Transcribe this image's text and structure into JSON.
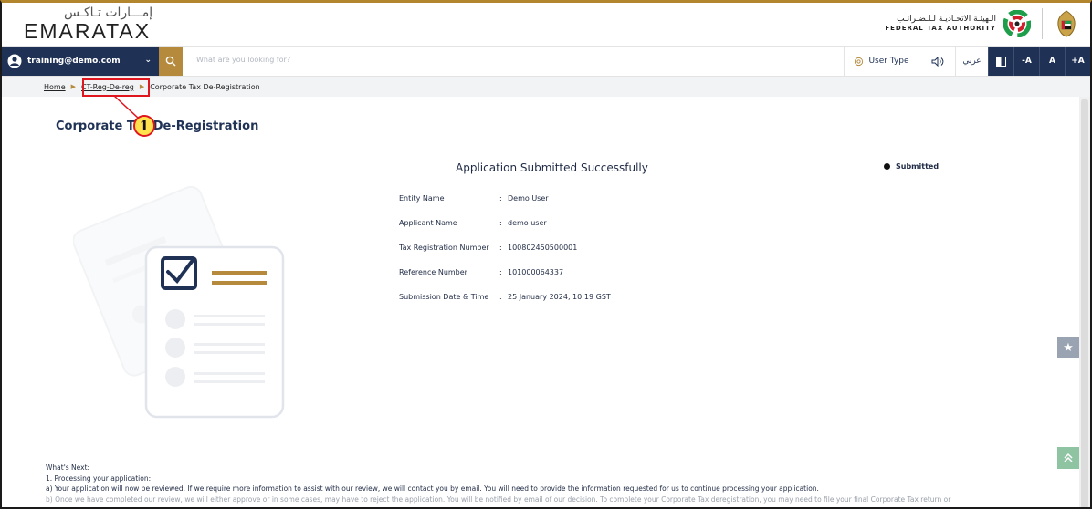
{
  "header": {
    "logo_ar": "إمـــارات تـاكـس",
    "logo_en": "EMARATAX",
    "fta_ar": "الـهيئـة الاتحـاديـة لـلـضـرائـب",
    "fta_en": "FEDERAL TAX AUTHORITY"
  },
  "nav": {
    "user_email": "training@demo.com",
    "search_placeholder": "What are you looking for?",
    "user_type_label": "User Type",
    "language_label": "عربي",
    "font_decrease": "-A",
    "font_normal": "A",
    "font_increase": "+A"
  },
  "breadcrumb": {
    "home": "Home",
    "parent": "CT-Reg-De-reg",
    "current": "Corporate Tax De-Registration"
  },
  "callout_number": "1",
  "page_title": "Corporate Tax De-Registration",
  "main": {
    "success_title": "Application Submitted Successfully",
    "status": "Submitted",
    "details": [
      {
        "label": "Entity Name",
        "value": "Demo User"
      },
      {
        "label": "Applicant Name",
        "value": "demo user"
      },
      {
        "label": "Tax Registration Number",
        "value": "100802450500001"
      },
      {
        "label": "Reference Number",
        "value": "101000064337"
      },
      {
        "label": "Submission Date & Time",
        "value": "25 January 2024, 10:19 GST"
      }
    ]
  },
  "whats_next": {
    "heading": "What's Next:",
    "step1": "1. Processing your application:",
    "step1a": "a) Your application will now be reviewed. If we require more information to assist with our review, we will contact you by email. You will need to provide the information requested for us to continue processing your application.",
    "step1b": "b) Once we have completed our review, we will either approve or in some cases, may have to reject the application. You will be notified by email of our decision. To complete your Corporate Tax deregistration, you may need to file your final Corporate Tax return or"
  },
  "colors": {
    "navy": "#1f3256",
    "gold": "#b58a3d",
    "highlight_red": "#e0161e",
    "callout_yellow": "#ffe24d"
  }
}
